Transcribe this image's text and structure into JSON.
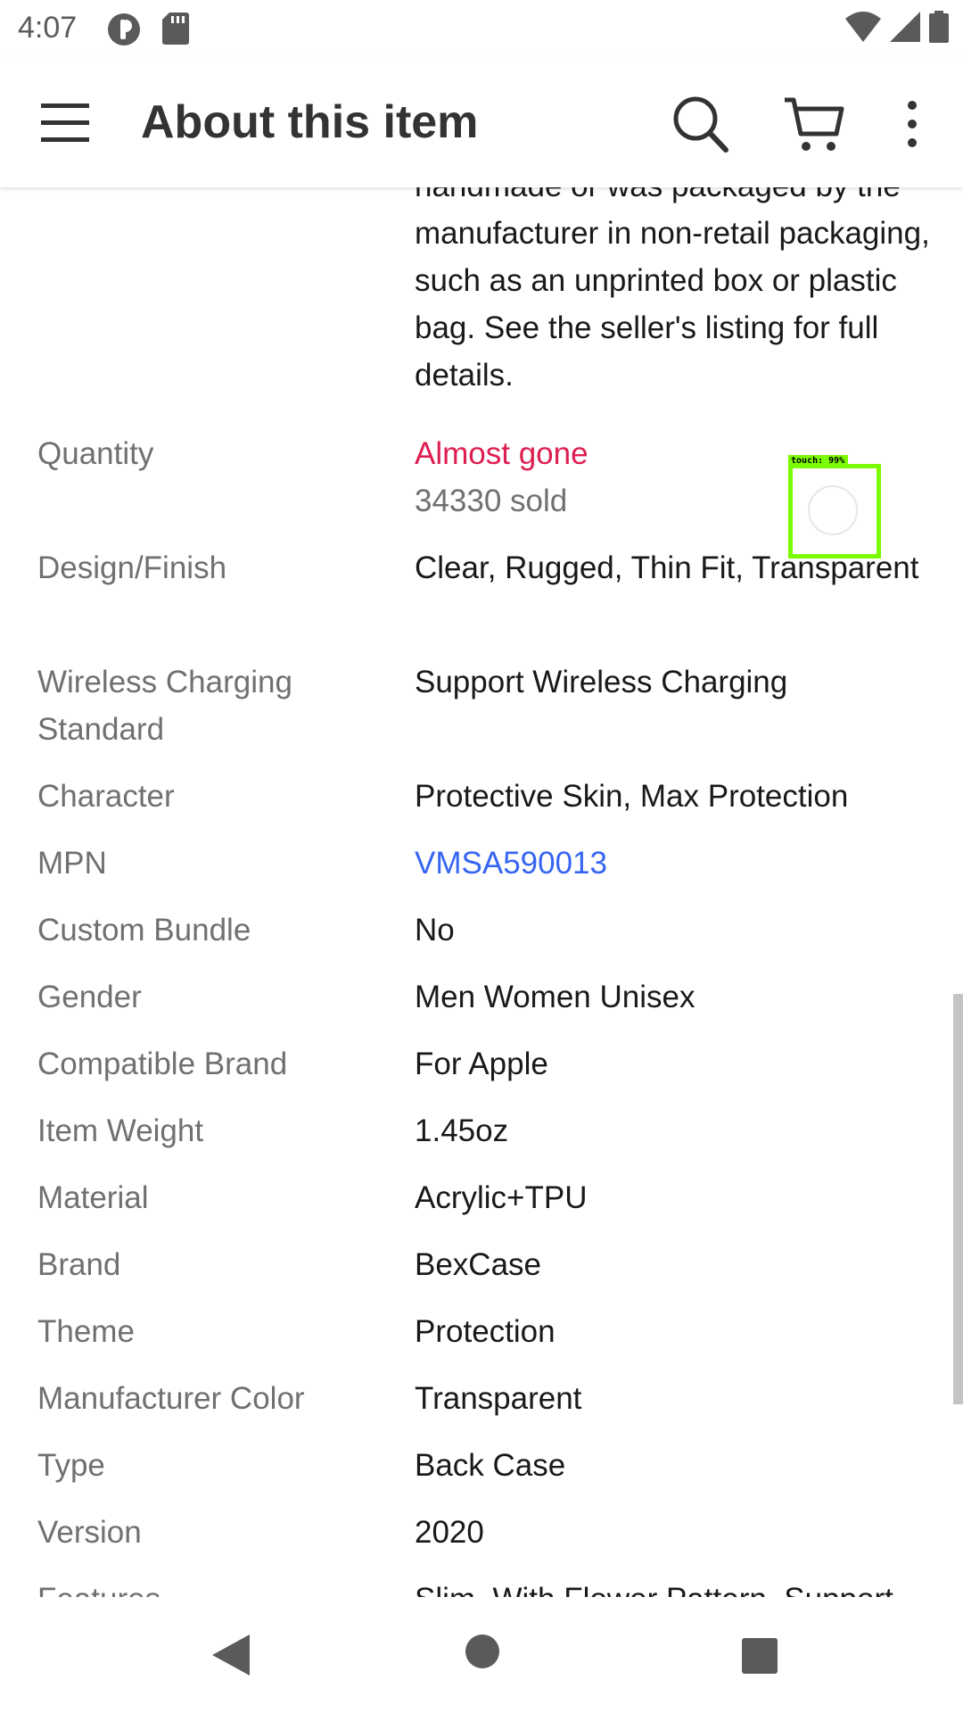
{
  "status_bar": {
    "time": "4:07"
  },
  "app_bar": {
    "title": "About this item"
  },
  "intro": {
    "text": "handmade or was packaged by the manufacturer in non-retail packaging, such as an unprinted box or plastic bag. See the seller's listing for full details."
  },
  "specs": [
    {
      "label": "Quantity",
      "value": "Almost gone",
      "sub": "34330 sold"
    },
    {
      "label": "Design/Finish",
      "value": "Clear, Rugged, Thin Fit, Transparent"
    },
    {
      "label": "Wireless Charging Standard",
      "value": "Support Wireless Charging"
    },
    {
      "label": "Character",
      "value": "Protective Skin, Max Protection"
    },
    {
      "label": "MPN",
      "value": "VMSA590013"
    },
    {
      "label": "Custom Bundle",
      "value": "No"
    },
    {
      "label": "Gender",
      "value": "Men Women Unisex"
    },
    {
      "label": "Compatible Brand",
      "value": "For Apple"
    },
    {
      "label": "Item Weight",
      "value": "1.45oz"
    },
    {
      "label": "Material",
      "value": "Acrylic+TPU"
    },
    {
      "label": "Brand",
      "value": "BexCase"
    },
    {
      "label": "Theme",
      "value": "Protection"
    },
    {
      "label": "Manufacturer Color",
      "value": "Transparent"
    },
    {
      "label": "Type",
      "value": "Back Case"
    },
    {
      "label": "Version",
      "value": "2020"
    },
    {
      "label": "Features",
      "value": "Slim, With Flower Pattern, Support"
    }
  ],
  "touch_overlay": {
    "label": "touch: 99%"
  },
  "icons": {
    "menu": "menu-icon",
    "search": "search-icon",
    "cart": "cart-icon",
    "more": "more-vert-icon",
    "back": "back-triangle-icon",
    "home": "home-circle-icon",
    "recent": "recents-square-icon"
  },
  "colors": {
    "alert": "#dd1e50",
    "link": "#3665f3",
    "label_gray": "#707070",
    "touch_overlay": "#7cfc00"
  }
}
